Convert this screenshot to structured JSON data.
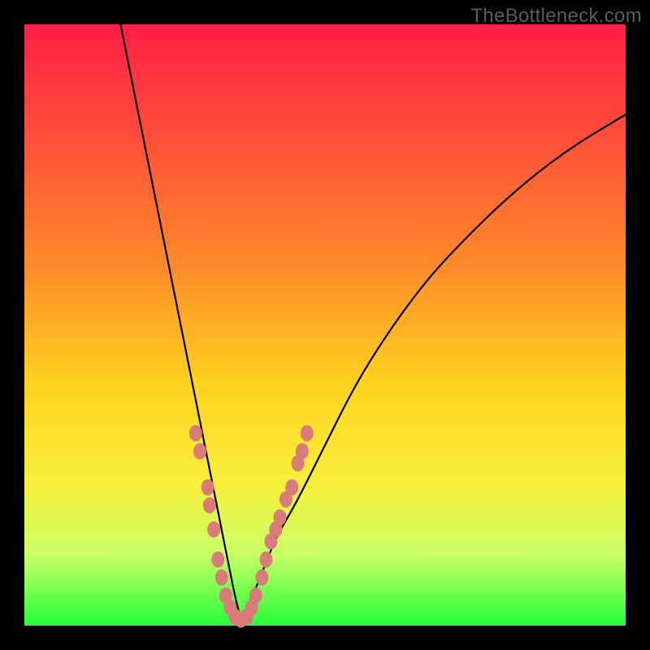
{
  "watermark": "TheBottleneck.com",
  "colors": {
    "background_black": "#000000",
    "gradient_top": "#ff1f47",
    "gradient_bottom": "#26ff3a",
    "curve_stroke": "#000000",
    "marker_fill": "#d97b7b"
  },
  "chart_data": {
    "type": "line",
    "title": "",
    "xlabel": "",
    "ylabel": "",
    "xlim": [
      0,
      100
    ],
    "ylim": [
      0,
      100
    ],
    "description": "Two black curves forming a V shape against a vertical red→green gradient. A cluster of salmon-colored point markers lies along both branches in the lower third of the chart, concentrated around the minimum.",
    "series": [
      {
        "name": "left-branch",
        "x": [
          16,
          18,
          20,
          22,
          24,
          26,
          28,
          30,
          31,
          32,
          33,
          34,
          35,
          36
        ],
        "y": [
          100,
          90,
          80,
          70,
          60,
          50,
          40,
          30,
          25,
          20,
          15,
          10,
          5,
          1
        ]
      },
      {
        "name": "right-branch",
        "x": [
          36,
          38,
          40,
          42,
          45,
          50,
          55,
          60,
          65,
          70,
          80,
          90,
          100
        ],
        "y": [
          1,
          5,
          10,
          15,
          20,
          30,
          40,
          48,
          55,
          61,
          71,
          79,
          85
        ]
      }
    ],
    "markers": [
      {
        "x": 28.5,
        "y": 32
      },
      {
        "x": 29.2,
        "y": 29
      },
      {
        "x": 30.5,
        "y": 23
      },
      {
        "x": 30.8,
        "y": 20
      },
      {
        "x": 31.5,
        "y": 16
      },
      {
        "x": 32.2,
        "y": 11
      },
      {
        "x": 32.8,
        "y": 8
      },
      {
        "x": 33.5,
        "y": 5
      },
      {
        "x": 34.2,
        "y": 3
      },
      {
        "x": 35.0,
        "y": 1.5
      },
      {
        "x": 36.0,
        "y": 1
      },
      {
        "x": 37.0,
        "y": 1.5
      },
      {
        "x": 37.8,
        "y": 3
      },
      {
        "x": 38.5,
        "y": 5
      },
      {
        "x": 39.5,
        "y": 8
      },
      {
        "x": 40.2,
        "y": 11
      },
      {
        "x": 41.0,
        "y": 14
      },
      {
        "x": 41.8,
        "y": 16
      },
      {
        "x": 42.5,
        "y": 18
      },
      {
        "x": 43.5,
        "y": 21
      },
      {
        "x": 44.5,
        "y": 23
      },
      {
        "x": 45.5,
        "y": 27
      },
      {
        "x": 46.2,
        "y": 29
      },
      {
        "x": 47.0,
        "y": 32
      }
    ]
  }
}
